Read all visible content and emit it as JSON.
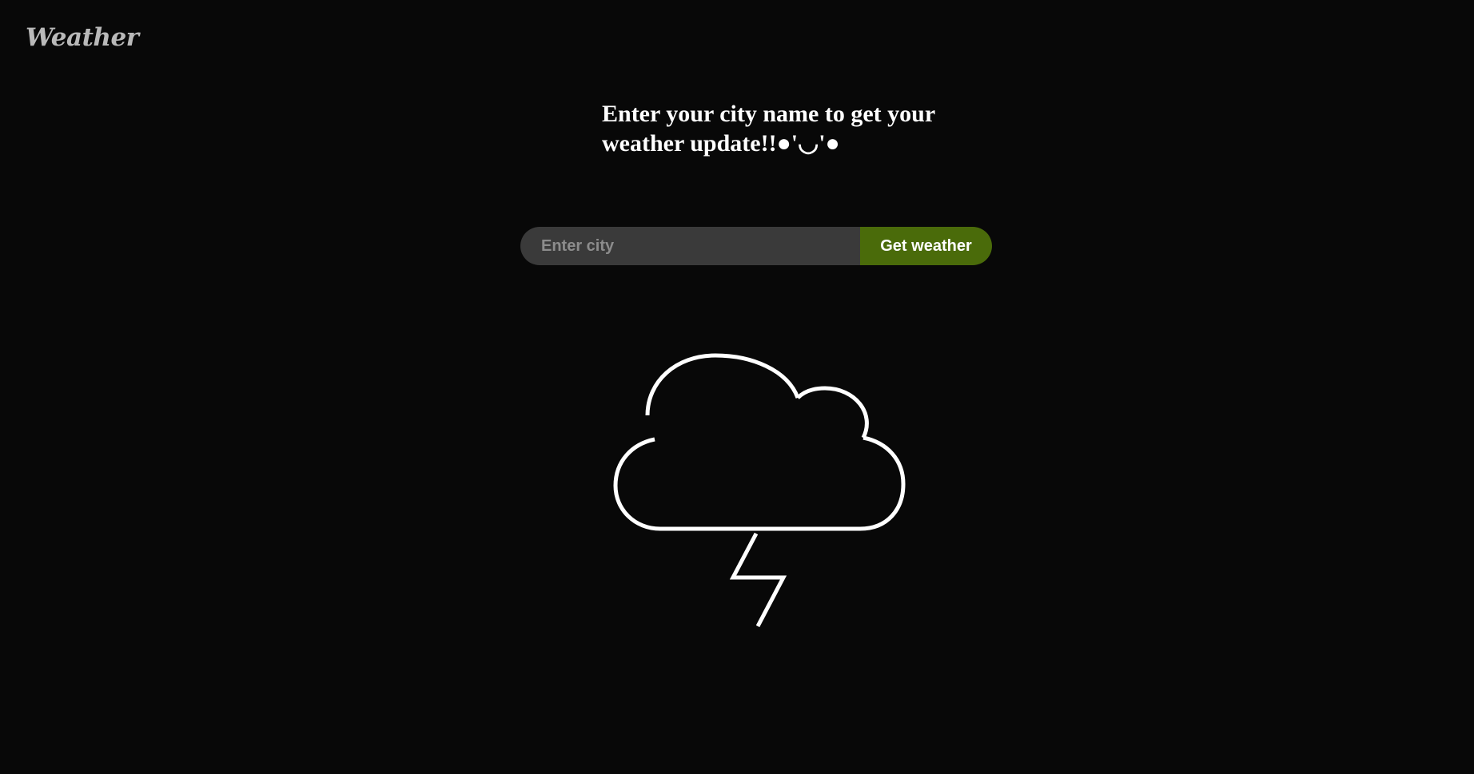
{
  "app": {
    "brand": "Weather"
  },
  "main": {
    "headline": "Enter your city name to get your weather update!!●'◡'●",
    "search": {
      "placeholder": "Enter city",
      "value": "",
      "button_label": "Get weather"
    },
    "weather_icon": "cloud-lightning-icon"
  },
  "colors": {
    "background": "#080808",
    "brand_text": "#b9b9b9",
    "input_bg": "#3a3a3a",
    "button_bg": "#4a6b0a",
    "icon_stroke": "#ffffff"
  }
}
